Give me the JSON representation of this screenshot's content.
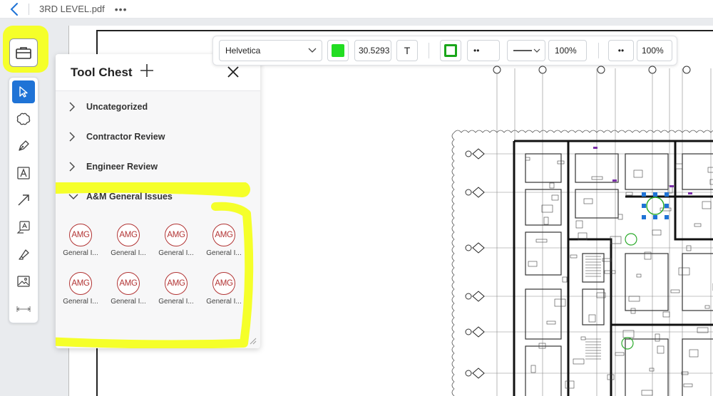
{
  "titlebar": {
    "doc_title": "3RD LEVEL.pdf",
    "more_label": "•••"
  },
  "left_toolbar": {
    "tools": [
      "select-arrow-icon",
      "cloud-shape-icon",
      "pen-icon",
      "text-box-icon",
      "arrow-icon",
      "callout-icon",
      "highlighter-icon",
      "image-icon",
      "measure-icon"
    ]
  },
  "tool_chest": {
    "title": "Tool Chest",
    "categories": [
      {
        "label": "Uncategorized",
        "expanded": false
      },
      {
        "label": "Contractor Review",
        "expanded": false
      },
      {
        "label": "Engineer Review",
        "expanded": false
      },
      {
        "label": "A&M General Issues",
        "expanded": true
      }
    ],
    "stamps": [
      {
        "code": "AMG",
        "label": "General I..."
      },
      {
        "code": "AMG",
        "label": "General I..."
      },
      {
        "code": "AMG",
        "label": "General I..."
      },
      {
        "code": "AMG",
        "label": "General I..."
      },
      {
        "code": "AMG",
        "label": "General I..."
      },
      {
        "code": "AMG",
        "label": "General I..."
      },
      {
        "code": "AMG",
        "label": "General I..."
      },
      {
        "code": "AMG",
        "label": "General I..."
      }
    ]
  },
  "property_bar": {
    "font_family": "Helvetica",
    "fill_color": "#22dd22",
    "font_size": "30.5293",
    "text_button": "T",
    "stroke_color": "#1aa61a",
    "line_style_dots": "••",
    "line_width_opacity": "100%",
    "dots2": "••",
    "fill_opacity": "100%"
  },
  "colors": {
    "accent": "#1f73d6",
    "highlight_yellow": "#f5ff2a",
    "stamp_red": "#b23434"
  }
}
